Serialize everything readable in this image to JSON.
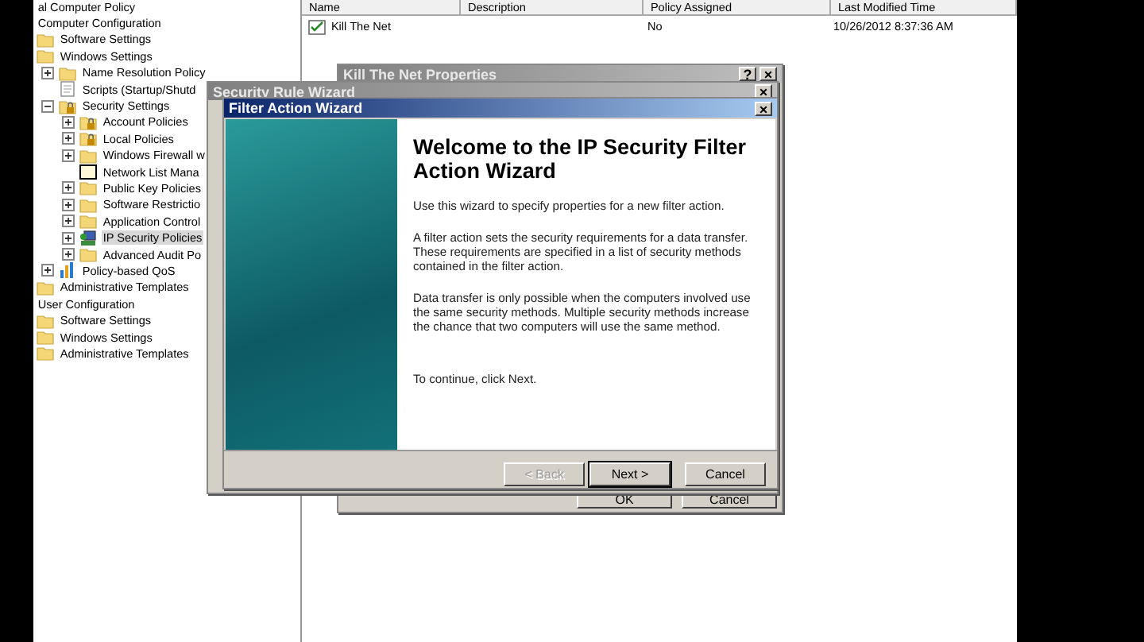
{
  "tree": {
    "items": [
      {
        "label": "al Computer Policy",
        "selected": false,
        "children": [
          {
            "label": "Computer Configuration",
            "selected": false,
            "children": [
              {
                "label": "Software Settings",
                "kind": "folder",
                "selected": false
              },
              {
                "label": "Windows Settings",
                "kind": "folder",
                "selected": false,
                "children": [
                  {
                    "label": "Name Resolution Policy",
                    "kind": "folder",
                    "expanded": false,
                    "selected": false
                  },
                  {
                    "label": "Scripts (Startup/Shutd",
                    "kind": "script",
                    "selected": false
                  },
                  {
                    "label": "Security Settings",
                    "kind": "locked-folder",
                    "expanded": true,
                    "selected": false,
                    "children": [
                      {
                        "label": "Account Policies",
                        "kind": "locked-folder",
                        "expanded": false,
                        "selected": false
                      },
                      {
                        "label": "Local Policies",
                        "kind": "locked-folder",
                        "expanded": false,
                        "selected": false
                      },
                      {
                        "label": "Windows Firewall w",
                        "kind": "folder",
                        "expanded": false,
                        "selected": false
                      },
                      {
                        "label": "Network List Mana",
                        "kind": "blank",
                        "selected": false
                      },
                      {
                        "label": "Public Key Policies",
                        "kind": "folder",
                        "expanded": false,
                        "selected": false
                      },
                      {
                        "label": "Software Restrictio",
                        "kind": "folder",
                        "expanded": false,
                        "selected": false
                      },
                      {
                        "label": "Application Control",
                        "kind": "folder",
                        "expanded": false,
                        "selected": false
                      },
                      {
                        "label": "IP Security Policies",
                        "kind": "network",
                        "expanded": false,
                        "selected": true
                      },
                      {
                        "label": "Advanced Audit Po",
                        "kind": "folder",
                        "expanded": false,
                        "selected": false
                      }
                    ]
                  },
                  {
                    "label": "Policy-based QoS",
                    "kind": "chart",
                    "expanded": false,
                    "selected": false
                  }
                ]
              },
              {
                "label": "Administrative Templates",
                "kind": "folder",
                "selected": false
              }
            ]
          },
          {
            "label": "User Configuration",
            "selected": false,
            "children": [
              {
                "label": "Software Settings",
                "kind": "folder",
                "selected": false
              },
              {
                "label": "Windows Settings",
                "kind": "folder",
                "selected": false
              },
              {
                "label": "Administrative Templates",
                "kind": "folder",
                "selected": false
              }
            ]
          }
        ]
      }
    ]
  },
  "table": {
    "columns": [
      "Name",
      "Description",
      "Policy Assigned",
      "Last Modified Time"
    ],
    "rows": [
      {
        "cells": [
          "Kill The Net",
          "",
          "No",
          "10/26/2012 8:37:36 AM"
        ]
      }
    ]
  },
  "properties_window": {
    "title": "Kill The Net Properties",
    "help": "?",
    "close": "×",
    "buttons": [
      "OK",
      "Cancel"
    ]
  },
  "rule_wizard": {
    "title": "Security Rule Wizard",
    "close": "×"
  },
  "filter_wizard": {
    "title": "Filter Action Wizard",
    "close": "×",
    "heading": "Welcome to the IP Security Filter Action Wizard",
    "paragraphs": [
      "Use this wizard to specify properties for a new filter action.",
      "A filter action sets the security requirements for a data transfer. These requirements are specified in a list of security methods contained in the filter action.",
      "Data transfer is only possible when the computers involved use the same security methods. Multiple security methods increase the chance that two computers will use the same method.",
      "To continue, click Next."
    ],
    "buttons": [
      {
        "label": "< Back",
        "disabled": true,
        "default": false
      },
      {
        "label": "Next >",
        "disabled": false,
        "default": true
      },
      {
        "label": "Cancel",
        "disabled": false,
        "default": false
      }
    ]
  }
}
